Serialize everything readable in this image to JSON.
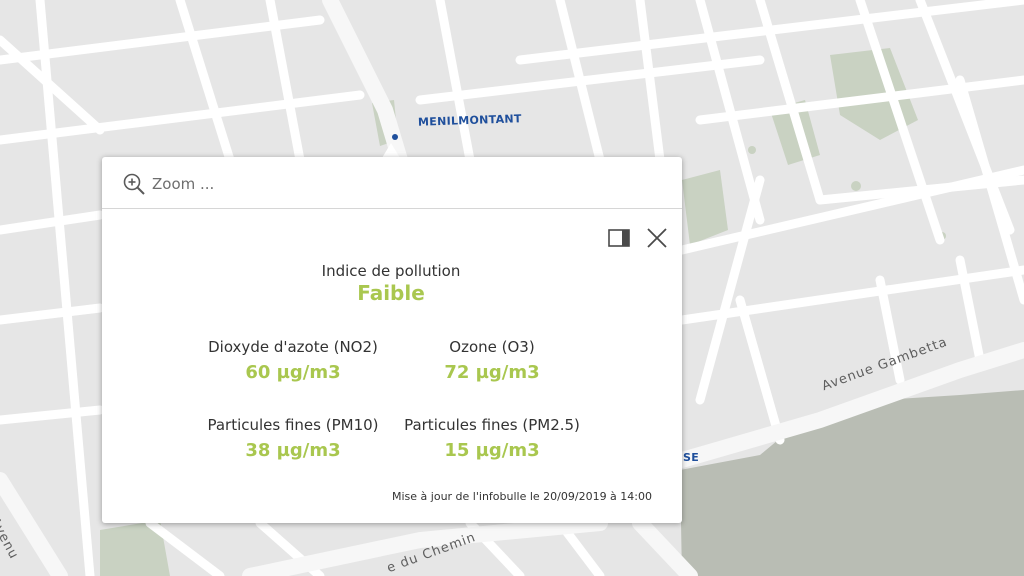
{
  "map": {
    "labels": {
      "district_north": "MENILMONTANT",
      "district_south_fragment": "SE",
      "street_gambetta": "Avenue Gambetta",
      "street_chemin_fragment": "e du Chemin",
      "street_left_fragment": "Avenu"
    }
  },
  "popup": {
    "zoom_label": "Zoom ...",
    "index": {
      "label": "Indice de pollution",
      "value": "Faible",
      "color": "#a9c74f"
    },
    "measures": [
      {
        "label": "Dioxyde d'azote (NO2)",
        "value": "60 µg/m3"
      },
      {
        "label": "Ozone (O3)",
        "value": "72 µg/m3"
      },
      {
        "label": "Particules fines (PM10)",
        "value": "38 µg/m3"
      },
      {
        "label": "Particules fines (PM2.5)",
        "value": "15 µg/m3"
      }
    ],
    "updated": "Mise à jour de l'infobulle le 20/09/2019 à 14:00",
    "icons": {
      "zoom": "zoom-in-icon",
      "dock": "dock-icon",
      "close": "close-icon"
    }
  }
}
